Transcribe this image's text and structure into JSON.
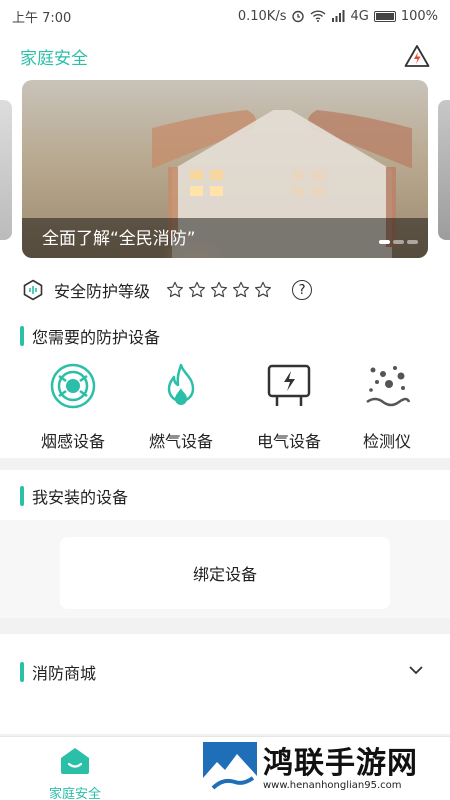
{
  "status_bar": {
    "time": "上午 7:00",
    "speed": "0.10K/s",
    "network": "4G",
    "battery": "100%"
  },
  "header": {
    "title": "家庭安全",
    "icon": "warning-triangle-icon"
  },
  "banner": {
    "caption": "全面了解“全民消防”",
    "pages": 3,
    "active_page": 0
  },
  "safety_level": {
    "label": "安全防护等级",
    "stars_filled": 0,
    "stars_total": 5
  },
  "sections": {
    "devices_title": "您需要的防护设备",
    "installed_title": "我安装的设备",
    "shop_title": "消防商城"
  },
  "devices": [
    {
      "label": "烟感设备",
      "icon": "smoke-detector-icon"
    },
    {
      "label": "燃气设备",
      "icon": "flame-icon"
    },
    {
      "label": "电气设备",
      "icon": "electric-board-icon"
    },
    {
      "label": "检测仪",
      "icon": "particles-icon"
    }
  ],
  "bind_button": "绑定设备",
  "bottom_nav": {
    "home_label": "家庭安全"
  },
  "watermark": {
    "title": "鸿联手游网",
    "url": "www.henanhonglian95.com"
  },
  "colors": {
    "accent": "#2bbfa8"
  }
}
